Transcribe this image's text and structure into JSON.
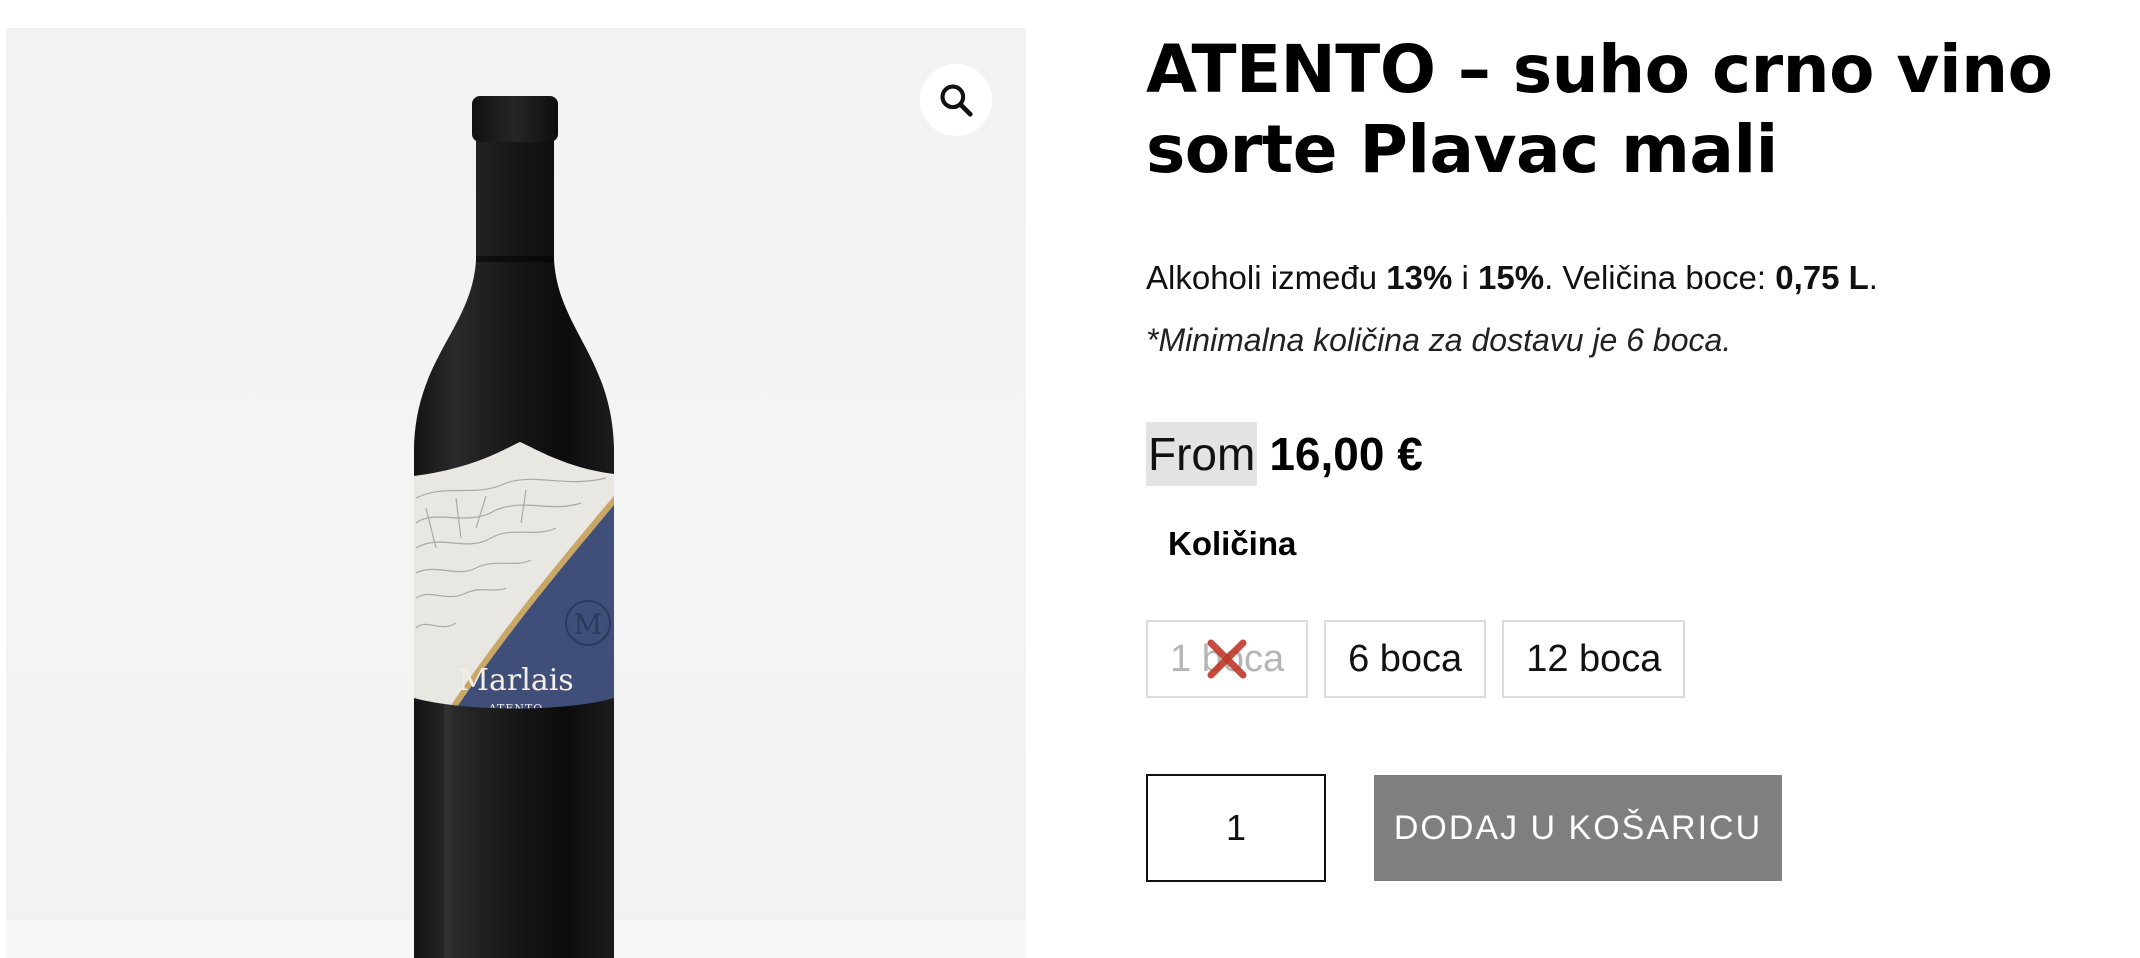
{
  "product": {
    "title": "ATENTO – suho crno vino sorte Plavac mali",
    "description": {
      "prefix": "Alkoholi između ",
      "alc_min": "13%",
      "between": " i ",
      "alc_max": "15%",
      "size_label": ". Veličina boce: ",
      "size_value": "0,75 L",
      "suffix": "."
    },
    "note": "*Minimalna količina za dostavu je 6 boca.",
    "price": {
      "from_label": "From",
      "amount": "16,00 €"
    }
  },
  "gallery": {
    "zoom_icon": "magnifier-icon",
    "label_brand": "Marlais",
    "label_product": "ATENTO",
    "label_monogram": "M"
  },
  "variation": {
    "label": "Količina",
    "options": [
      {
        "label": "1 boca",
        "available": false
      },
      {
        "label": "6 boca",
        "available": true
      },
      {
        "label": "12 boca",
        "available": true
      }
    ]
  },
  "cart": {
    "quantity": "1",
    "add_button": "DODAJ U KOŠARICU"
  },
  "colors": {
    "button_bg": "#7f7f7f",
    "unavailable_cross": "#c0392b",
    "label_blue": "#3f4f7a"
  }
}
